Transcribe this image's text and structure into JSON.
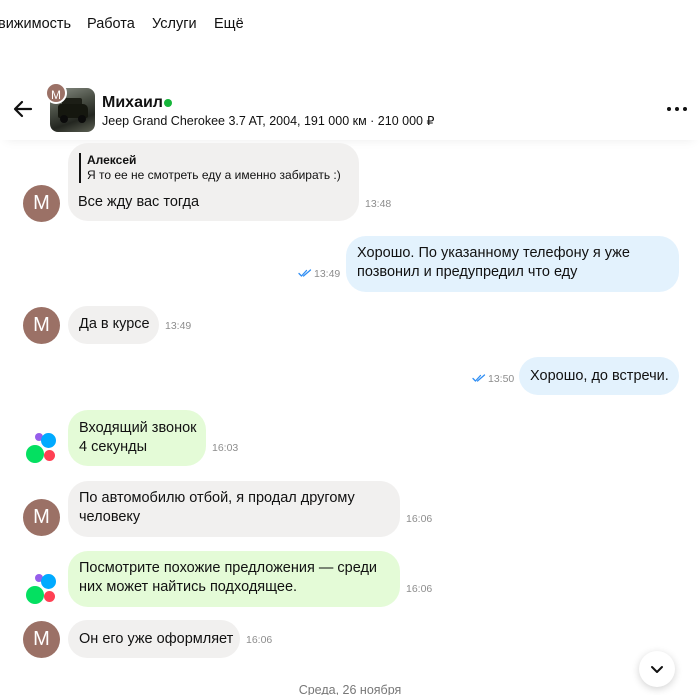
{
  "topnav": {
    "items": [
      "вижимость",
      "Работа",
      "Услуги",
      "Ещё"
    ]
  },
  "header": {
    "contact_name": "Михаил",
    "avatar_letter": "М",
    "ad_title": "Jeep Grand Cherokee 3.7 AT, 2004, 191 000 км · 210 000 ₽",
    "online_color": "#16b53a"
  },
  "messages": [
    {
      "direction": "in",
      "quote_author": "Алексей",
      "quote_text": "Я то ее не смотреть еду а именно забирать :)",
      "text": "Все жду вас тогда",
      "time": "13:48"
    },
    {
      "direction": "out",
      "text": "Хорошо. По указанному телефону я уже позвонил и предупредил что еду",
      "time": "13:49"
    },
    {
      "direction": "in",
      "text": "Да в курсе",
      "time": "13:49"
    },
    {
      "direction": "out",
      "text": "Хорошо, до встречи.",
      "time": "13:50"
    },
    {
      "direction": "system",
      "text": "Входящий звонок 4 секунды",
      "time": "16:03"
    },
    {
      "direction": "in",
      "text": "По автомобилю отбой, я продал другому человеку",
      "time": "16:06"
    },
    {
      "direction": "system",
      "text": "Посмотрите похожие предложения — среди них может найтись подходящее.",
      "time": "16:06"
    },
    {
      "direction": "in",
      "text": "Он его уже оформляет",
      "time": "16:06"
    }
  ],
  "date_separator": "Среда, 26 ноября",
  "colors": {
    "incoming": "#f1f0ef",
    "outgoing": "#e3f2fd",
    "system": "#e4fbd7",
    "avatar": "#9b7166",
    "read_ticks": "#2f8ef4"
  }
}
